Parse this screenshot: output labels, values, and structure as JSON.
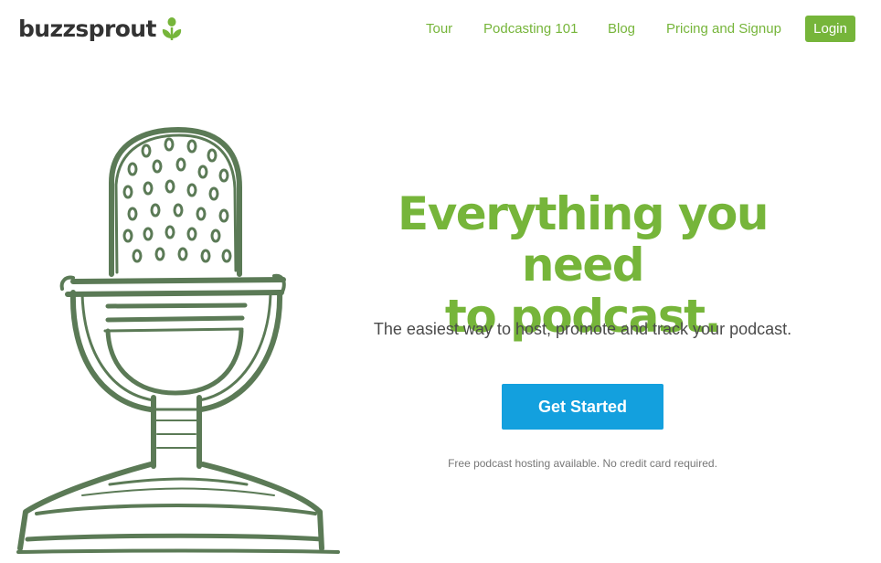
{
  "brand": {
    "name": "buzzsprout",
    "logo_icon": "sprout-icon"
  },
  "nav": {
    "items": [
      {
        "label": "Tour"
      },
      {
        "label": "Podcasting 101"
      },
      {
        "label": "Blog"
      },
      {
        "label": "Pricing and Signup"
      }
    ],
    "login_label": "Login"
  },
  "hero": {
    "headline_line1": "Everything you need",
    "headline_line2": "to podcast.",
    "tagline": "The easiest way to host, promote and track your podcast.",
    "cta_label": "Get Started",
    "note": "Free podcast hosting available. No credit card required.",
    "illustration": "microphone-illustration"
  },
  "colors": {
    "brand_green": "#76b53a",
    "cta_blue": "#13a0de",
    "mic_green": "#5b7a56",
    "logo_text": "#333333"
  }
}
